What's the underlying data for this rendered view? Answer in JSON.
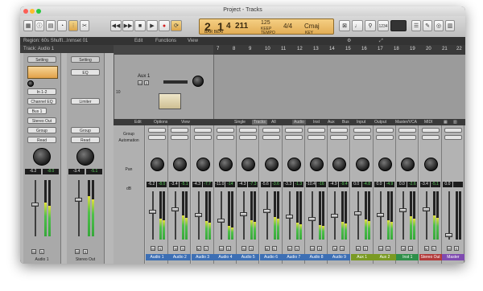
{
  "window": {
    "title": "Project - Tracks"
  },
  "toolbar": {
    "lcd": {
      "bar": "2",
      "beat": "1",
      "sub": "4",
      "tick": "211",
      "tempo": "125",
      "tempo_label": "KEEP",
      "time_sig": "4/4",
      "key": "Cmaj",
      "sub_label": "BAR  BEAT",
      "tempo_sub": "TEMPO",
      "key_sub": "KEY"
    },
    "cpu_label": "1234"
  },
  "region_bar": {
    "label": "Region: 60s Shuffl...Inmset 01"
  },
  "track_bar": {
    "label": "Track:  Audio 1"
  },
  "arrange_menu": {
    "edit": "Edit",
    "functions": "Functions",
    "view": "View"
  },
  "ruler": {
    "numbers": [
      "7",
      "8",
      "9",
      "10",
      "11",
      "12",
      "13",
      "14",
      "15",
      "16",
      "17",
      "18",
      "19",
      "20",
      "21",
      "22"
    ]
  },
  "arrange_track": {
    "name": "Aux 1",
    "track_number": "10",
    "m": "M",
    "s": "S"
  },
  "inspector": {
    "strip1": {
      "setting": "Setting",
      "eq": "EQ",
      "input": "In 1-2",
      "plugin": "Channel EQ",
      "send": "Bus 1",
      "output": "Stereo Out",
      "group": "Group",
      "read": "Read",
      "pan_val": "-6.2",
      "db_val": "-8.0",
      "m": "M",
      "s": "S",
      "name": "Audio 1"
    },
    "strip2": {
      "setting": "Setting",
      "eq": "EQ",
      "plugin": "Limiter",
      "group": "Group",
      "read": "Read",
      "pan_val": "-3.4",
      "db_val": "-5.1",
      "m": "M",
      "s": "S",
      "name": "Stereo Out"
    }
  },
  "mixer_menu": {
    "edit": "Edit",
    "options": "Options",
    "view": "View",
    "tabs": [
      "Single",
      "Tracks",
      "All",
      "Audio",
      "Inst",
      "Aux",
      "Bus",
      "Input",
      "Output",
      "Master/VCA",
      "MIDI"
    ],
    "row_labels": {
      "group": "Group",
      "automation": "Automation",
      "pan": "Pan",
      "db": "dB"
    }
  },
  "channels": [
    {
      "name": "Audio 1",
      "pan": "-6.2",
      "db": "-8.0",
      "level": 0.55,
      "color": "#3d6fb4"
    },
    {
      "name": "Audio 2",
      "pan": "-3.4",
      "db": "-5.1",
      "level": 0.62,
      "color": "#3d6fb4"
    },
    {
      "name": "Audio 3",
      "pan": "-4.3",
      "db": "-7.7",
      "level": 0.48,
      "color": "#3d6fb4"
    },
    {
      "name": "Audio 4",
      "pan": "-11.0",
      "db": "-14",
      "level": 0.35,
      "color": "#3d6fb4"
    },
    {
      "name": "Audio 5",
      "pan": "-4.3",
      "db": "-7.3",
      "level": 0.5,
      "color": "#3d6fb4"
    },
    {
      "name": "Audio 6",
      "pan": "-5.6",
      "db": "-3.6",
      "level": 0.58,
      "color": "#3d6fb4"
    },
    {
      "name": "Audio 7",
      "pan": "-3.3",
      "db": "-1.3",
      "level": 0.44,
      "color": "#3d6fb4"
    },
    {
      "name": "Audio 8",
      "pan": "-10.4",
      "db": "-16",
      "level": 0.38,
      "color": "#3d6fb4"
    },
    {
      "name": "Audio 9",
      "pan": "-4.9",
      "db": "-9.4",
      "level": 0.46,
      "color": "#3d6fb4"
    },
    {
      "name": "Aux 1",
      "pan": "0.0",
      "db": "-4.8",
      "level": 0.52,
      "color": "#7a9a23"
    },
    {
      "name": "Aux 2",
      "pan": "0.0",
      "db": "-4.9",
      "level": 0.49,
      "color": "#7a9a23"
    },
    {
      "name": "Inst 1",
      "pan": "0.0",
      "db": "-2.6",
      "level": 0.6,
      "color": "#2f8f4a"
    },
    {
      "name": "Stereo Out",
      "pan": "-3.4",
      "db": "-5.1",
      "level": 0.62,
      "color": "#b23a3a"
    },
    {
      "name": "Master",
      "pan": "0.0",
      "db": "",
      "level": 0.0,
      "color": "#7f4bb0"
    }
  ]
}
